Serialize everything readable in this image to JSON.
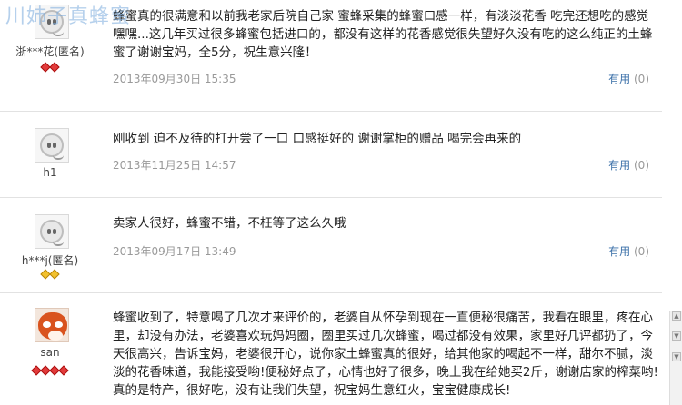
{
  "watermark": "川姉子真蜂蜜",
  "reviews": [
    {
      "user": "浙***花(匿名)",
      "content": "蜂蜜真的很满意和以前我老家后院自己家 蜜蜂采集的蜂蜜口感一样，有淡淡花香 吃完还想吃的感觉嘿嘿...这几年买过很多蜂蜜包括进口的，都没有这样的花香感觉很失望好久没有吃的这么纯正的土蜂蜜了谢谢宝妈，全5分，祝生意兴隆！",
      "date": "2013年09月30日 15:35",
      "useful_label": "有用",
      "useful_count": "(0)",
      "badges": [
        "red",
        "red"
      ]
    },
    {
      "user": "h1",
      "content": "刚收到 迫不及待的打开尝了一口 口感挺好的 谢谢掌柜的赠品 喝完会再来的",
      "date": "2013年11月25日 14:57",
      "useful_label": "有用",
      "useful_count": "(0)",
      "badges": []
    },
    {
      "user": "h***j(匿名)",
      "content": "卖家人很好，蜂蜜不错，不枉等了这么久哦",
      "date": "2013年09月17日 13:49",
      "useful_label": "有用",
      "useful_count": "(0)",
      "badges": [
        "gold",
        "gold"
      ]
    },
    {
      "user": "san",
      "content": "蜂蜜收到了，特意喝了几次才来评价的，老婆自从怀孕到现在一直便秘很痛苦，我看在眼里，疼在心里，却没有办法，老婆喜欢玩妈妈圈，圈里买过几次蜂蜜，喝过都没有效果，家里好几评都扔了，今天很高兴，告诉宝妈，老婆很开心，说你家土蜂蜜真的很好，给其他家的喝起不一样，甜尔不腻，淡淡的花香味道，我能接受哟!便秘好点了，心情也好了很多，晚上我在给她买2斤，谢谢店家的榨菜哟!真的是特产，很好吃，没有让我们失望，祝宝妈生意红火，宝宝健康成长!",
      "date": "",
      "useful_label": "",
      "useful_count": "",
      "badges": [
        "red",
        "red",
        "red",
        "red"
      ]
    }
  ]
}
